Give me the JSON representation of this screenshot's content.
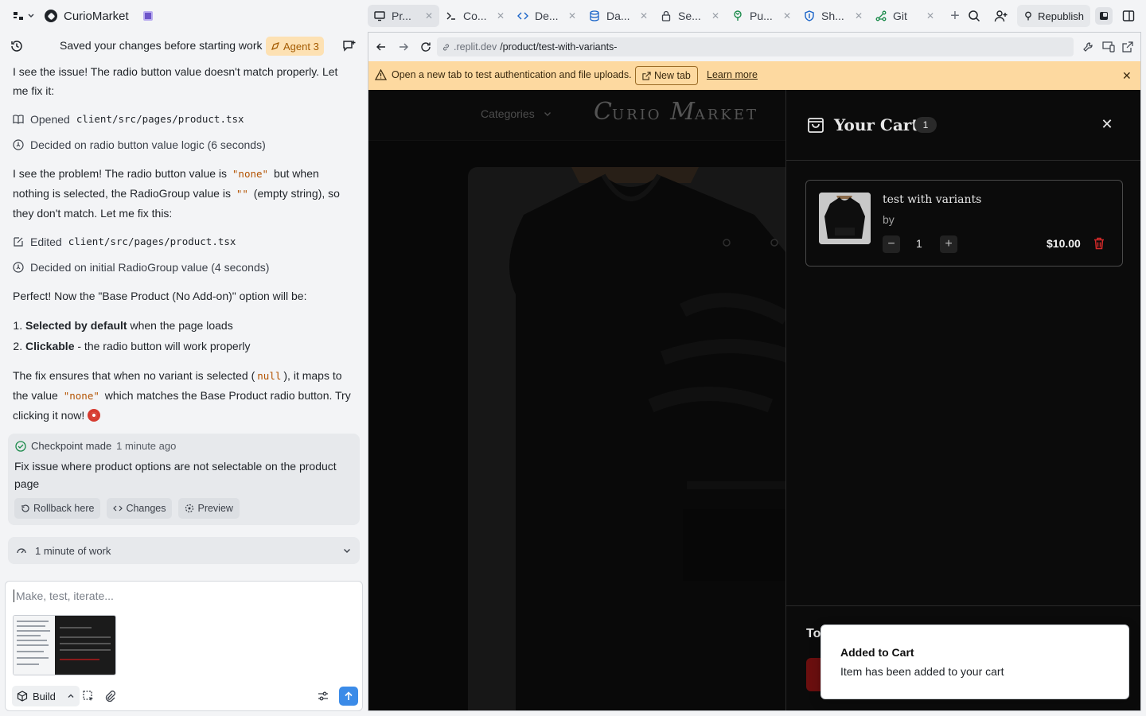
{
  "topbar": {
    "app_name": "CurioMarket",
    "tabs": [
      {
        "label": "Pr...",
        "icon": "monitor-icon",
        "active": true
      },
      {
        "label": "Co...",
        "icon": "terminal-icon"
      },
      {
        "label": "De...",
        "icon": "code-icon"
      },
      {
        "label": "Da...",
        "icon": "database-icon"
      },
      {
        "label": "Se...",
        "icon": "lock-icon"
      },
      {
        "label": "Pu...",
        "icon": "publish-icon"
      },
      {
        "label": "Sh...",
        "icon": "shield-icon"
      },
      {
        "label": "Git",
        "icon": "git-icon"
      }
    ],
    "republish_label": "Republish"
  },
  "chat": {
    "header_message": "Saved your changes before starting work",
    "agent_badge": "Agent 3",
    "messages": {
      "p1": "I see the issue! The radio button value doesn't match properly. Let me fix it:",
      "a1_verb": "Opened",
      "a1_file": "client/src/pages/product.tsx",
      "a2": "Decided on radio button value logic (6 seconds)",
      "p2_a": "I see the problem! The radio button value is",
      "p2_code1": "\"none\"",
      "p2_b": "but when nothing is selected, the RadioGroup value is",
      "p2_code2": "\"\"",
      "p2_c": "(empty string), so they don't match. Let me fix this:",
      "a3_verb": "Edited",
      "a3_file": "client/src/pages/product.tsx",
      "a4": "Decided on initial RadioGroup value (4 seconds)",
      "p3": "Perfect! Now the \"Base Product (No Add-on)\" option will be:",
      "li1_bold": "Selected by default",
      "li1_rest": "when the page loads",
      "li2_bold": "Clickable",
      "li2_rest": "- the radio button will work properly",
      "p4_a": "The fix ensures that when no variant is selected (",
      "p4_code1": "null",
      "p4_b": "), it maps to the value",
      "p4_code2": "\"none\"",
      "p4_c": "which matches the Base Product radio button. Try clicking it now!"
    },
    "checkpoint": {
      "label": "Checkpoint made",
      "time": "1 minute ago",
      "description": "Fix issue where product options are not selectable on the product page",
      "rollback": "Rollback here",
      "changes": "Changes",
      "preview": "Preview"
    },
    "work_summary": "1 minute of work",
    "composer": {
      "placeholder": "Make, test, iterate...",
      "mode_label": "Build"
    }
  },
  "browser": {
    "url_domain": ".replit.dev",
    "url_path": "/product/test-with-variants-",
    "warning_text": "Open a new tab to test authentication and file uploads.",
    "new_tab_label": "New tab",
    "learn_more": "Learn more"
  },
  "site": {
    "nav_categories": "Categories",
    "brand_c": "C",
    "brand_urio": "URIO",
    "brand_m": "M",
    "brand_arket": "ARKET"
  },
  "cart": {
    "title": "Your Cart",
    "count": "1",
    "item": {
      "name": "test with variants",
      "by": "by",
      "quantity": "1",
      "price": "$10.00"
    },
    "total_label": "To"
  },
  "toast": {
    "title": "Added to Cart",
    "description": "Item has been added to your cart"
  }
}
